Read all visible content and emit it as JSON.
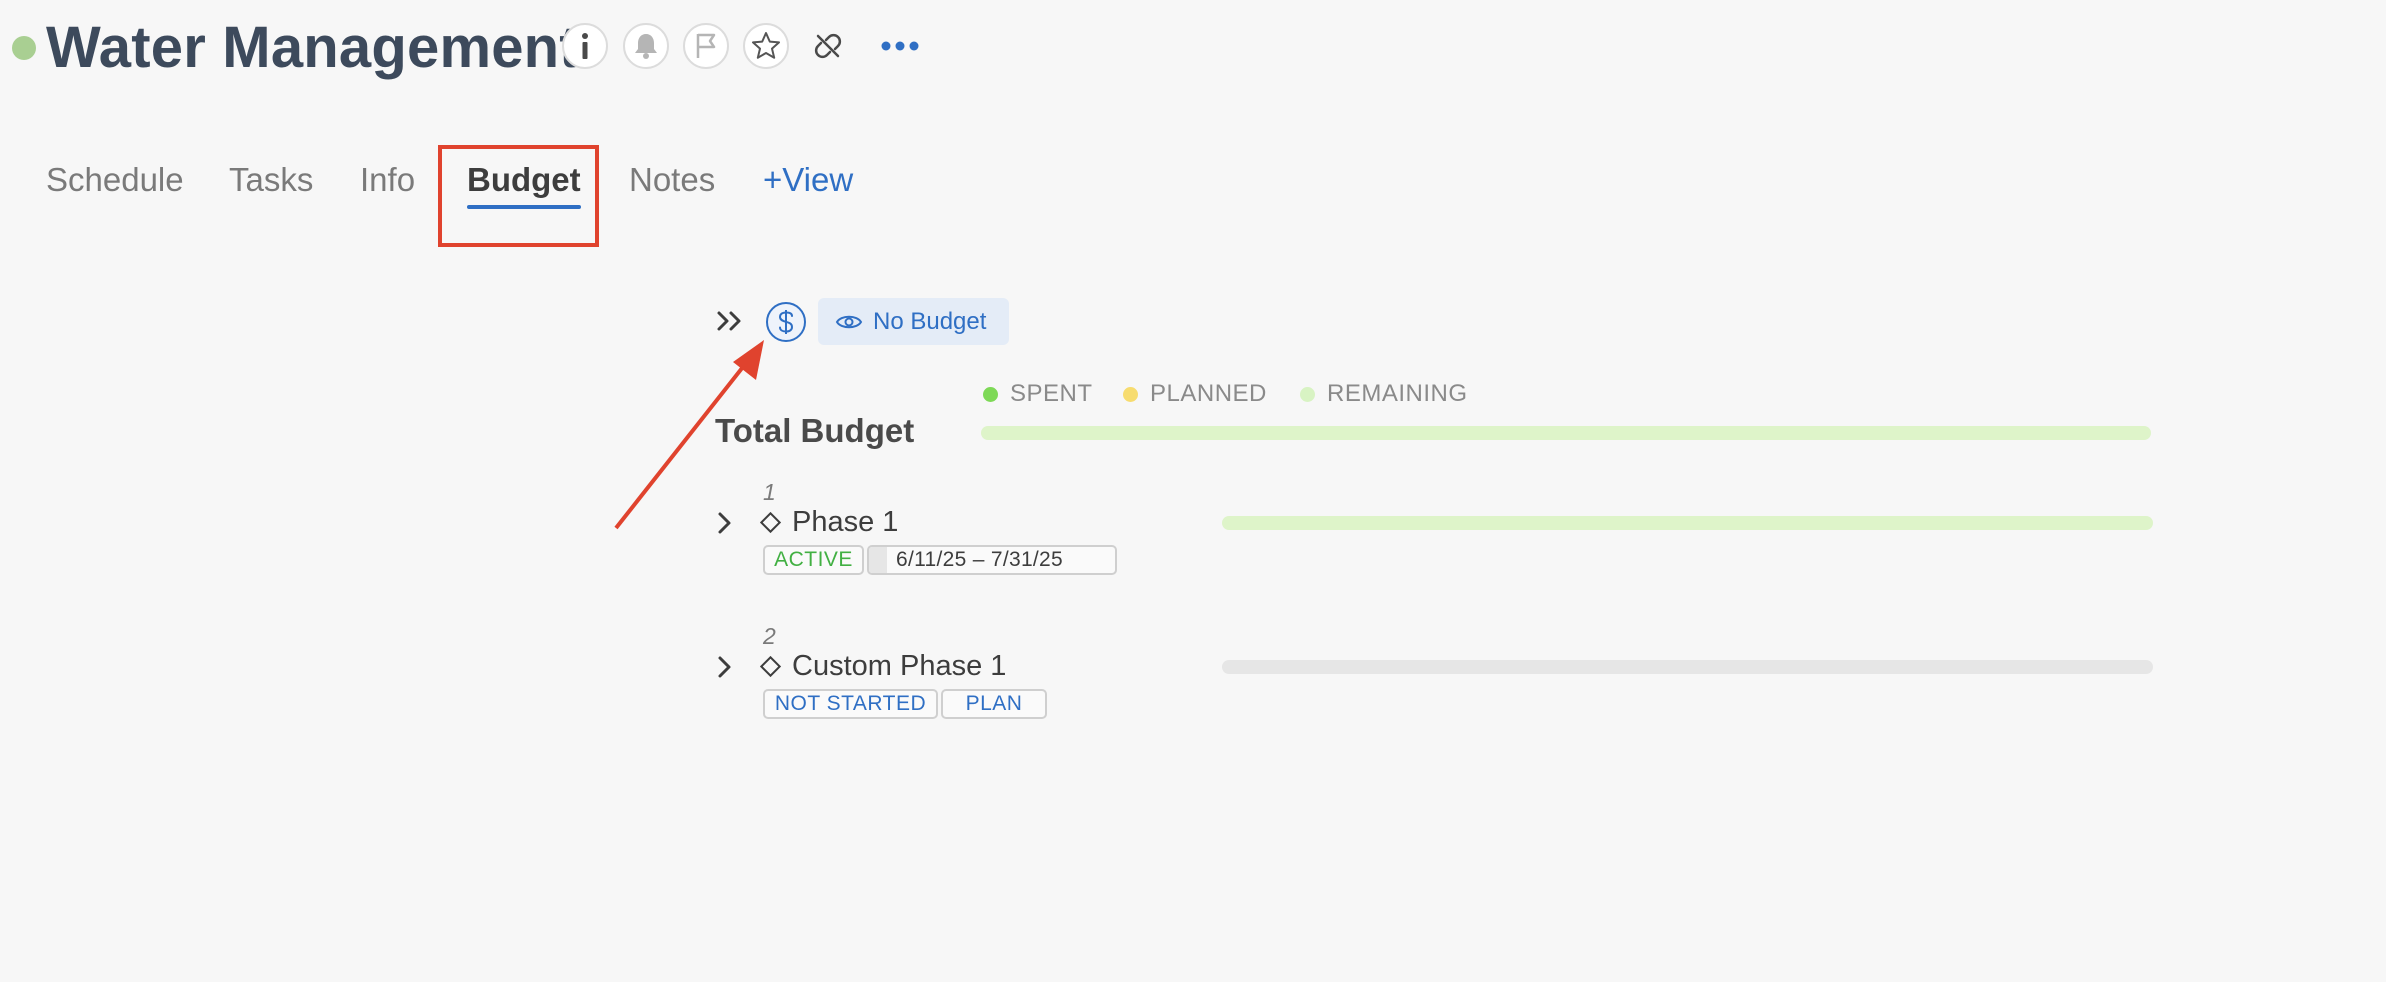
{
  "header": {
    "title": "Water Management",
    "status_color": "#a9cf92",
    "icons": [
      "info-icon",
      "bell-icon",
      "flag-icon",
      "star-icon",
      "unlink-icon",
      "more-icon"
    ]
  },
  "tabs": [
    {
      "label": "Schedule",
      "active": false
    },
    {
      "label": "Tasks",
      "active": false
    },
    {
      "label": "Info",
      "active": false
    },
    {
      "label": "Budget",
      "active": true
    },
    {
      "label": "Notes",
      "active": false
    },
    {
      "label": "+View",
      "active": false
    }
  ],
  "toolbar": {
    "budget_filter_label": "No Budget",
    "icons": [
      "double-chevron-right-icon",
      "dollar-icon",
      "eye-icon"
    ]
  },
  "legend": [
    {
      "label": "SPENT",
      "color": "#7ed957"
    },
    {
      "label": "PLANNED",
      "color": "#f7dc6f"
    },
    {
      "label": "REMAINING",
      "color": "#d8f3c3"
    }
  ],
  "total_budget": {
    "label": "Total Budget",
    "bar_color": "#def4c9"
  },
  "phases": [
    {
      "number": "1",
      "name": "Phase 1",
      "status": "ACTIVE",
      "dates": "6/11/25  –  7/31/25",
      "bar_color": "#def4c9"
    },
    {
      "number": "2",
      "name": "Custom Phase 1",
      "status": "NOT STARTED",
      "plan_label": "PLAN",
      "bar_color": "#e6e6e6"
    }
  ],
  "colors": {
    "accent_blue": "#2f6fc4",
    "annotation_red": "#e0432e"
  }
}
